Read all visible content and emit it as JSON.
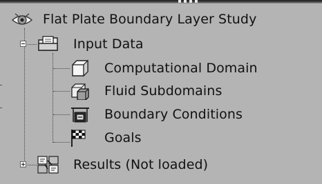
{
  "tree": {
    "root": {
      "label": "Flat Plate Boundary Layer Study",
      "icon": "analysis-eye-icon"
    },
    "nodes": [
      {
        "label": "Input Data",
        "icon": "document-folder-icon",
        "expanded": true
      },
      {
        "label": "Computational Domain",
        "icon": "cube-domain-icon"
      },
      {
        "label": "Fluid Subdomains",
        "icon": "fluid-subdomain-icon"
      },
      {
        "label": "Boundary Conditions",
        "icon": "boundary-conditions-icon"
      },
      {
        "label": "Goals",
        "icon": "checkered-flag-icon"
      },
      {
        "label": "Results (Not loaded)",
        "icon": "results-icon",
        "expanded": false
      }
    ]
  }
}
